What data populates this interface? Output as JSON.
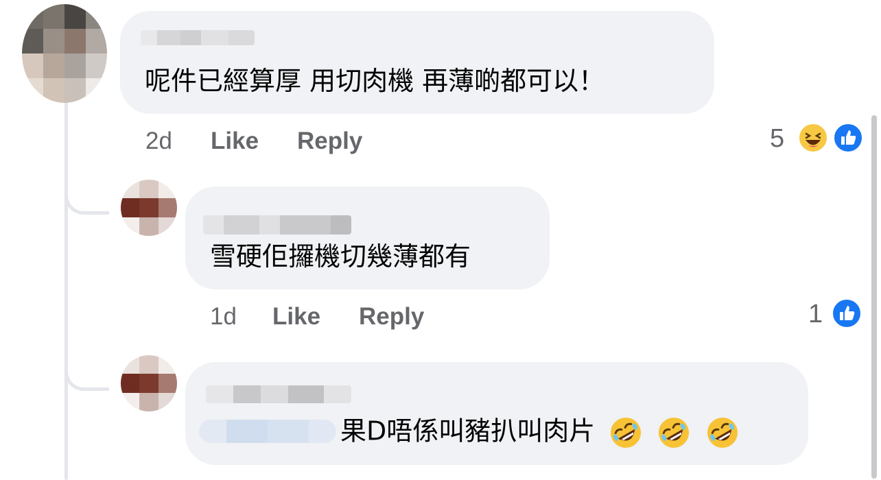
{
  "comments": [
    {
      "text": "呢件已經算厚 用切肉機 再薄啲都可以！",
      "time": "2d",
      "like_label": "Like",
      "reply_label": "Reply",
      "reaction_count": "5",
      "reactions": [
        "haha-icon",
        "like-icon"
      ]
    }
  ],
  "replies": [
    {
      "text": "雪硬佢攞機切幾薄都有",
      "time": "1d",
      "like_label": "Like",
      "reply_label": "Reply",
      "reaction_count": "1",
      "reactions": [
        "like-icon"
      ]
    },
    {
      "text": "果D唔係叫豬扒叫肉片",
      "emojis": [
        "rolling-on-floor-laughing-icon",
        "rolling-on-floor-laughing-icon",
        "rolling-on-floor-laughing-icon"
      ]
    }
  ],
  "colors": {
    "bubble": "#f0f2f5",
    "like_blue": "#1877f2",
    "meta_gray": "#65676b",
    "thread_line": "#e4e6eb"
  }
}
